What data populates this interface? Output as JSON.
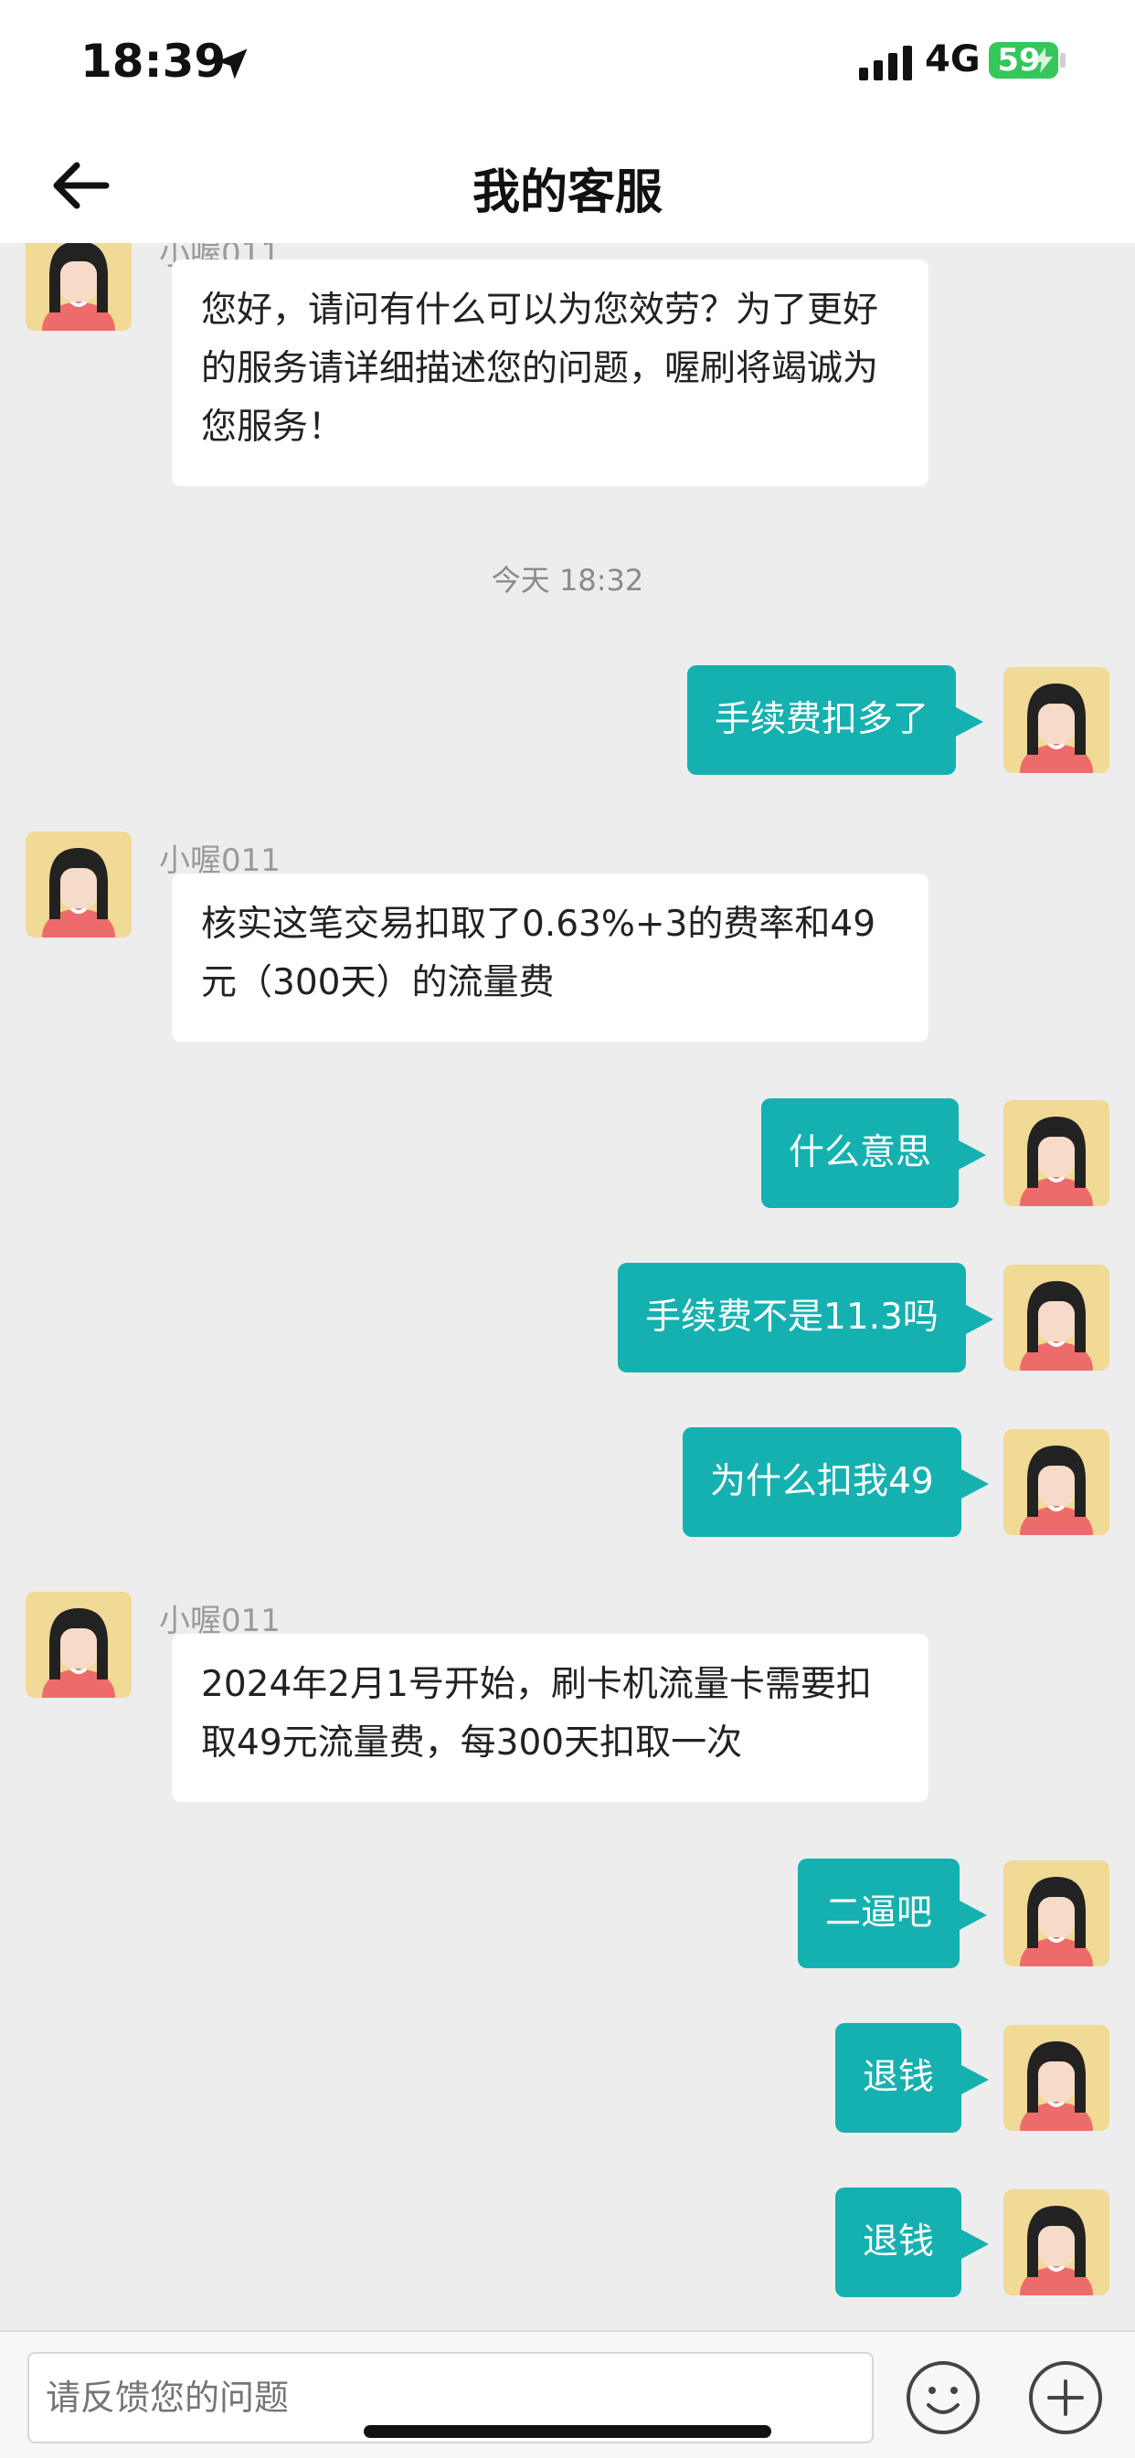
{
  "status_bar": {
    "time": "18:39",
    "network": "4G",
    "battery": "59"
  },
  "header": {
    "title": "我的客服"
  },
  "messages": [
    {
      "side": "in",
      "sender": "小喔011",
      "text": "您好，请问有什么可以为您效劳？为了更好的服务请详细描述您的问题，喔刷将竭诚为您服务！"
    },
    {
      "type": "timestamp",
      "text": "今天 18:32"
    },
    {
      "side": "out",
      "text": "手续费扣多了"
    },
    {
      "side": "in",
      "sender": "小喔011",
      "text": "核实这笔交易扣取了0.63%+3的费率和49元（300天）的流量费"
    },
    {
      "side": "out",
      "text": "什么意思"
    },
    {
      "side": "out",
      "text": "手续费不是11.3吗"
    },
    {
      "side": "out",
      "text": "为什么扣我49"
    },
    {
      "side": "in",
      "sender": "小喔011",
      "text": "2024年2月1号开始，刷卡机流量卡需要扣取49元流量费，每300天扣取一次"
    },
    {
      "side": "out",
      "text": "二逼吧"
    },
    {
      "side": "out",
      "text": "退钱"
    },
    {
      "side": "out",
      "text": "退钱"
    }
  ],
  "input": {
    "placeholder": "请反馈您的问题"
  },
  "icons": {
    "back": "arrow-left-icon",
    "location": "location-arrow-icon",
    "emoji": "smiley-icon",
    "plus": "plus-icon"
  },
  "colors": {
    "accent": "#15b1b0",
    "background": "#ededed",
    "avatar_bg": "#f1d996"
  }
}
